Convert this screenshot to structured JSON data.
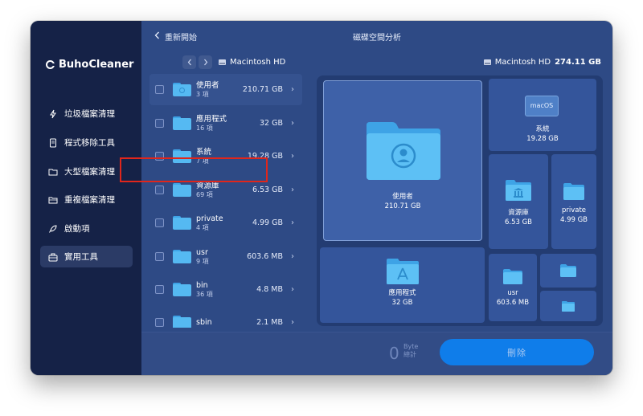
{
  "sidebar": {
    "app_name": "BuhoCleaner",
    "items": [
      {
        "label": "垃圾檔案清理",
        "icon": "lightning-icon",
        "active": false
      },
      {
        "label": "程式移除工具",
        "icon": "document-icon",
        "active": false
      },
      {
        "label": "大型檔案清理",
        "icon": "folder-icon",
        "active": false
      },
      {
        "label": "重複檔案清理",
        "icon": "duplicate-folder-icon",
        "active": false
      },
      {
        "label": "啟動項",
        "icon": "rocket-icon",
        "active": false
      },
      {
        "label": "實用工具",
        "icon": "toolbox-icon",
        "active": true
      }
    ]
  },
  "topbar": {
    "back_label": "重新開始",
    "title": "磁碟空間分析"
  },
  "path": {
    "current": "Macintosh HD"
  },
  "disk": {
    "name": "Macintosh HD",
    "size": "274.11 GB"
  },
  "files": [
    {
      "name": "使用者",
      "count": "3 項",
      "size": "210.71 GB",
      "emblem": "user"
    },
    {
      "name": "應用程式",
      "count": "16 項",
      "size": "32 GB",
      "emblem": "app"
    },
    {
      "name": "系統",
      "count": "7 項",
      "size": "19.28 GB",
      "emblem": "macos"
    },
    {
      "name": "資源庫",
      "count": "69 項",
      "size": "6.53 GB",
      "emblem": "library"
    },
    {
      "name": "private",
      "count": "4 項",
      "size": "4.99 GB",
      "emblem": "none"
    },
    {
      "name": "usr",
      "count": "9 項",
      "size": "603.6 MB",
      "emblem": "none"
    },
    {
      "name": "bin",
      "count": "36 項",
      "size": "4.8 MB",
      "emblem": "none"
    },
    {
      "name": "sbin",
      "count": "",
      "size": "2.1 MB",
      "emblem": "none"
    }
  ],
  "treemap": {
    "tiles": [
      {
        "name": "使用者",
        "size": "210.71 GB"
      },
      {
        "name": "系統",
        "size": "19.28 GB",
        "badge": "macOS"
      },
      {
        "name": "資源庫",
        "size": "6.53 GB"
      },
      {
        "name": "private",
        "size": "4.99 GB"
      },
      {
        "name": "應用程式",
        "size": "32 GB"
      },
      {
        "name": "usr",
        "size": "603.6 MB"
      }
    ]
  },
  "footer": {
    "selected_value": "0",
    "unit_line1": "Byte",
    "unit_line2": "總計",
    "delete_label": "刪除"
  },
  "colors": {
    "sidebar_bg": "#152247",
    "main_bg": "#2e4a85",
    "accent": "#0f7dea",
    "folder": "#55b9f2",
    "highlight": "#e0261b"
  }
}
